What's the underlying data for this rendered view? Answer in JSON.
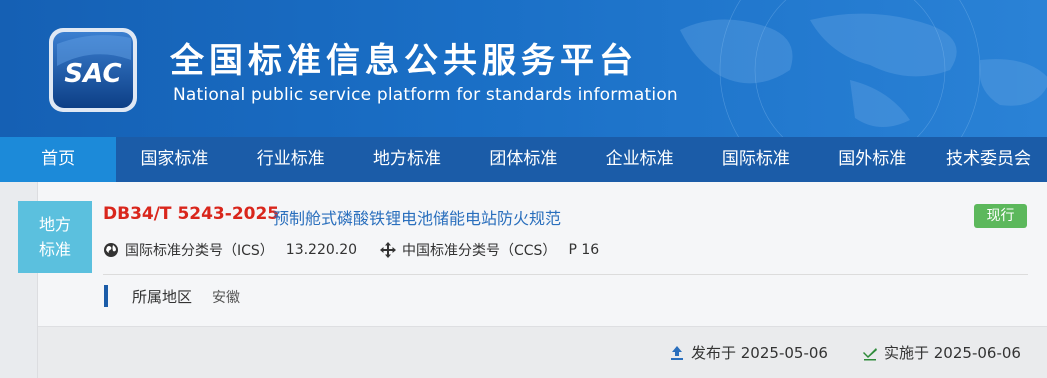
{
  "header": {
    "logo_text": "SAC",
    "title_cn": "全国标准信息公共服务平台",
    "title_en": "National public service platform  for standards information"
  },
  "nav": {
    "items": [
      {
        "label": "首页",
        "active": true
      },
      {
        "label": "国家标准"
      },
      {
        "label": "行业标准"
      },
      {
        "label": "地方标准"
      },
      {
        "label": "团体标准"
      },
      {
        "label": "企业标准"
      },
      {
        "label": "国际标准"
      },
      {
        "label": "国外标准"
      },
      {
        "label": "技术委员会"
      }
    ]
  },
  "standard": {
    "category_badge": [
      "地方",
      "标准"
    ],
    "code": "DB34/T 5243-2025",
    "name": "预制舱式磷酸铁锂电池储能电站防火规范",
    "status": "现行",
    "ics_label": "国际标准分类号（ICS）",
    "ics_value": "13.220.20",
    "ccs_label": "中国标准分类号（CCS）",
    "ccs_value": "P 16",
    "region_label": "所属地区",
    "region_value": "安徽"
  },
  "dates": {
    "published": "发布于 2025-05-06",
    "effective": "实施于 2025-06-06"
  },
  "colors": {
    "header_bg": "#1a6fc6",
    "nav_bg": "#1b5ca8",
    "nav_active": "#1c8ad9",
    "code_red": "#d9261c",
    "name_blue": "#2a6fbd",
    "status_green": "#5cb85c",
    "badge_cyan": "#5bc0de"
  }
}
